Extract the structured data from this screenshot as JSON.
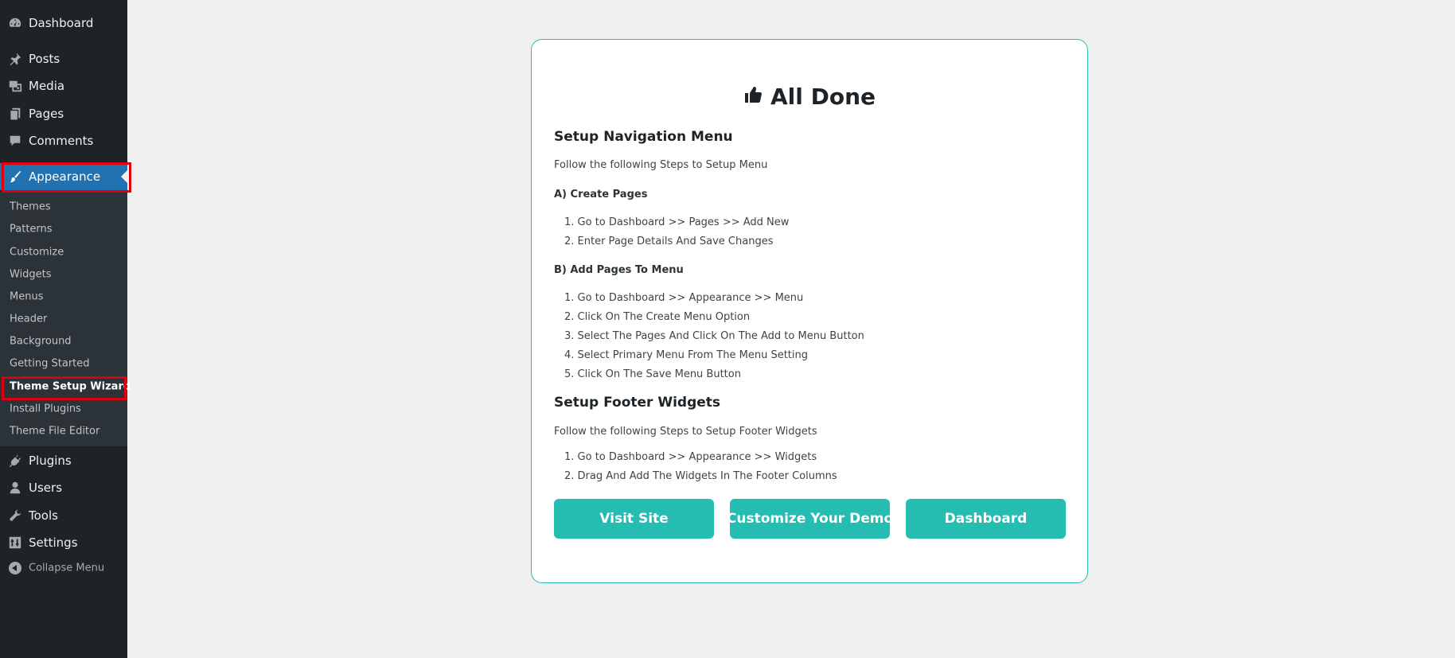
{
  "sidebar": {
    "menu": [
      {
        "id": "dashboard",
        "label": "Dashboard",
        "icon": "dashboard-gauge-icon"
      },
      {
        "id": "posts",
        "label": "Posts",
        "icon": "pin-icon"
      },
      {
        "id": "media",
        "label": "Media",
        "icon": "media-icon"
      },
      {
        "id": "pages",
        "label": "Pages",
        "icon": "pages-icon"
      },
      {
        "id": "comments",
        "label": "Comments",
        "icon": "speech-bubble-icon"
      },
      {
        "id": "appearance",
        "label": "Appearance",
        "icon": "paintbrush-icon"
      }
    ],
    "submenu": [
      "Themes",
      "Patterns",
      "Customize",
      "Widgets",
      "Menus",
      "Header",
      "Background",
      "Getting Started",
      "Theme Setup Wizard",
      "Install Plugins",
      "Theme File Editor"
    ],
    "menu_bottom": [
      {
        "id": "plugins",
        "label": "Plugins",
        "icon": "plug-icon"
      },
      {
        "id": "users",
        "label": "Users",
        "icon": "user-icon"
      },
      {
        "id": "tools",
        "label": "Tools",
        "icon": "wrench-icon"
      },
      {
        "id": "settings",
        "label": "Settings",
        "icon": "sliders-icon"
      }
    ],
    "collapse_label": "Collapse Menu",
    "active_color": "#2271b1",
    "highlight_color": "#e0000b"
  },
  "card": {
    "title": "All Done",
    "title_icon": "thumbs-up-icon",
    "nav_heading": "Setup Navigation Menu",
    "nav_intro": "Follow the following Steps to Setup Menu",
    "create_pages_heading": "A) Create Pages",
    "create_pages_steps": [
      "1. Go to Dashboard >> Pages >> Add New",
      "2. Enter Page Details And Save Changes"
    ],
    "add_pages_heading": "B) Add Pages To Menu",
    "add_pages_steps": [
      "1. Go to Dashboard >> Appearance >> Menu",
      "2. Click On The Create Menu Option",
      "3. Select The Pages And Click On The Add to Menu Button",
      "4. Select Primary Menu From The Menu Setting",
      "5. Click On The Save Menu Button"
    ],
    "footer_heading": "Setup Footer Widgets",
    "footer_intro": "Follow the following Steps to Setup Footer Widgets",
    "footer_steps": [
      "1. Go to Dashboard >> Appearance >> Widgets",
      "2. Drag And Add The Widgets In The Footer Columns"
    ],
    "buttons": {
      "visit_site": "Visit Site",
      "customize_demo": "Customize Your Demo",
      "dashboard": "Dashboard"
    },
    "accent_color": "#25bdb1"
  }
}
